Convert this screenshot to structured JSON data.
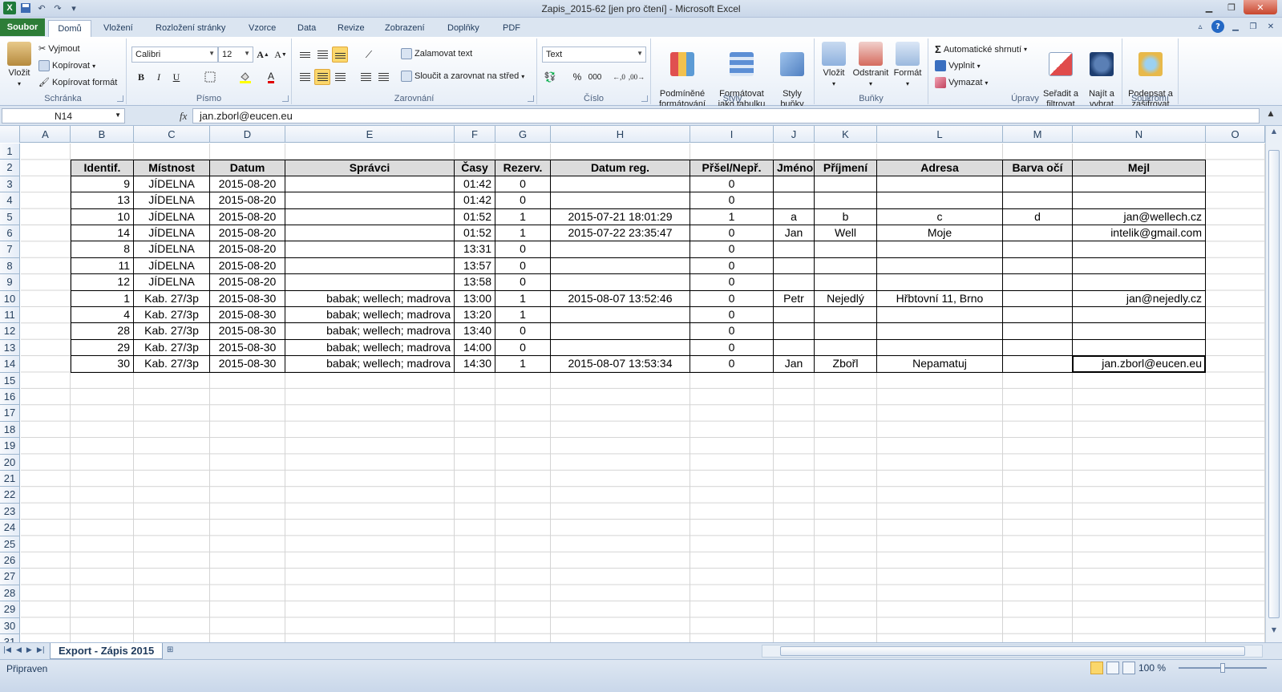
{
  "window": {
    "title": "Zapis_2015-62  [jen pro čtení]  -  Microsoft Excel"
  },
  "tabs": [
    {
      "label": "Soubor"
    },
    {
      "label": "Domů"
    },
    {
      "label": "Vložení"
    },
    {
      "label": "Rozložení stránky"
    },
    {
      "label": "Vzorce"
    },
    {
      "label": "Data"
    },
    {
      "label": "Revize"
    },
    {
      "label": "Zobrazení"
    },
    {
      "label": "Doplňky"
    },
    {
      "label": "PDF"
    }
  ],
  "ribbon": {
    "clipboard": {
      "label": "Schránka",
      "paste": "Vložit",
      "cut": "Vyjmout",
      "copy": "Kopírovat",
      "format_painter": "Kopírovat formát"
    },
    "font": {
      "label": "Písmo",
      "name": "Calibri",
      "size": "12",
      "bold": "B",
      "italic": "I",
      "underline": "U"
    },
    "alignment": {
      "label": "Zarovnání",
      "wrap": "Zalamovat text",
      "merge": "Sloučit a zarovnat na střed"
    },
    "number": {
      "label": "Číslo",
      "format": "Text",
      "percent": "%",
      "thousands": "000"
    },
    "styles": {
      "label": "Styly",
      "conditional": "Podmíněné\nformátování",
      "as_table": "Formátovat\njako tabulku",
      "cell_styles": "Styly\nbuňky"
    },
    "cells": {
      "label": "Buňky",
      "insert": "Vložit",
      "delete": "Odstranit",
      "format": "Formát"
    },
    "editing": {
      "label": "Úpravy",
      "autosum": "Automatické shrnutí",
      "fill": "Vyplnit",
      "clear": "Vymazat",
      "sort": "Seřadit a\nfiltrovat",
      "find": "Najít a\nvybrat"
    },
    "privacy": {
      "label": "Soukromí",
      "sign": "Podepsat a\nzašifrovat"
    }
  },
  "formula_bar": {
    "name_box": "N14",
    "fx": "fx",
    "content": "jan.zborl@eucen.eu"
  },
  "columns": [
    "A",
    "B",
    "C",
    "D",
    "E",
    "F",
    "G",
    "H",
    "I",
    "J",
    "K",
    "L",
    "M",
    "N",
    "O"
  ],
  "rows": [
    "1",
    "2",
    "3",
    "4",
    "5",
    "6",
    "7",
    "8",
    "9",
    "10",
    "11",
    "12",
    "13",
    "14",
    "15",
    "16",
    "17",
    "18",
    "19",
    "20",
    "21",
    "22",
    "23",
    "24",
    "25",
    "26",
    "27",
    "28",
    "29",
    "30",
    "31"
  ],
  "table": {
    "headers": [
      "Identif.",
      "Místnost",
      "Datum",
      "Správci",
      "Časy",
      "Rezerv.",
      "Datum reg.",
      "Přšel/Nepř.",
      "Jméno",
      "Příjmení",
      "Adresa",
      "Barva očí",
      "Mejl"
    ],
    "rows": [
      [
        "9",
        "JÍDELNA",
        "2015-08-20",
        "",
        "01:42",
        "0",
        "",
        "0",
        "",
        "",
        "",
        "",
        ""
      ],
      [
        "13",
        "JÍDELNA",
        "2015-08-20",
        "",
        "01:42",
        "0",
        "",
        "0",
        "",
        "",
        "",
        "",
        ""
      ],
      [
        "10",
        "JÍDELNA",
        "2015-08-20",
        "",
        "01:52",
        "1",
        "2015-07-21 18:01:29",
        "1",
        "a",
        "b",
        "c",
        "d",
        "jan@wellech.cz"
      ],
      [
        "14",
        "JÍDELNA",
        "2015-08-20",
        "",
        "01:52",
        "1",
        "2015-07-22 23:35:47",
        "0",
        "Jan",
        "Well",
        "Moje",
        "",
        "intelik@gmail.com"
      ],
      [
        "8",
        "JÍDELNA",
        "2015-08-20",
        "",
        "13:31",
        "0",
        "",
        "0",
        "",
        "",
        "",
        "",
        ""
      ],
      [
        "11",
        "JÍDELNA",
        "2015-08-20",
        "",
        "13:57",
        "0",
        "",
        "0",
        "",
        "",
        "",
        "",
        ""
      ],
      [
        "12",
        "JÍDELNA",
        "2015-08-20",
        "",
        "13:58",
        "0",
        "",
        "0",
        "",
        "",
        "",
        "",
        ""
      ],
      [
        "1",
        "Kab. 27/3p",
        "2015-08-30",
        "babak; wellech; madrova",
        "13:00",
        "1",
        "2015-08-07 13:52:46",
        "0",
        "Petr",
        "Nejedlý",
        "Hřbtovní 11, Brno",
        "",
        "jan@nejedly.cz"
      ],
      [
        "4",
        "Kab. 27/3p",
        "2015-08-30",
        "babak; wellech; madrova",
        "13:20",
        "1",
        "",
        "0",
        "",
        "",
        "",
        "",
        ""
      ],
      [
        "28",
        "Kab. 27/3p",
        "2015-08-30",
        "babak; wellech; madrova",
        "13:40",
        "0",
        "",
        "0",
        "",
        "",
        "",
        "",
        ""
      ],
      [
        "29",
        "Kab. 27/3p",
        "2015-08-30",
        "babak; wellech; madrova",
        "14:00",
        "0",
        "",
        "0",
        "",
        "",
        "",
        "",
        ""
      ],
      [
        "30",
        "Kab. 27/3p",
        "2015-08-30",
        "babak; wellech; madrova",
        "14:30",
        "1",
        "2015-08-07 13:53:34",
        "0",
        "Jan",
        "Zbořl",
        "Nepamatuj",
        "",
        "jan.zborl@eucen.eu"
      ]
    ]
  },
  "sheet_tab": "Export - Zápis 2015",
  "status": {
    "text": "Připraven",
    "zoom": "100 %"
  }
}
